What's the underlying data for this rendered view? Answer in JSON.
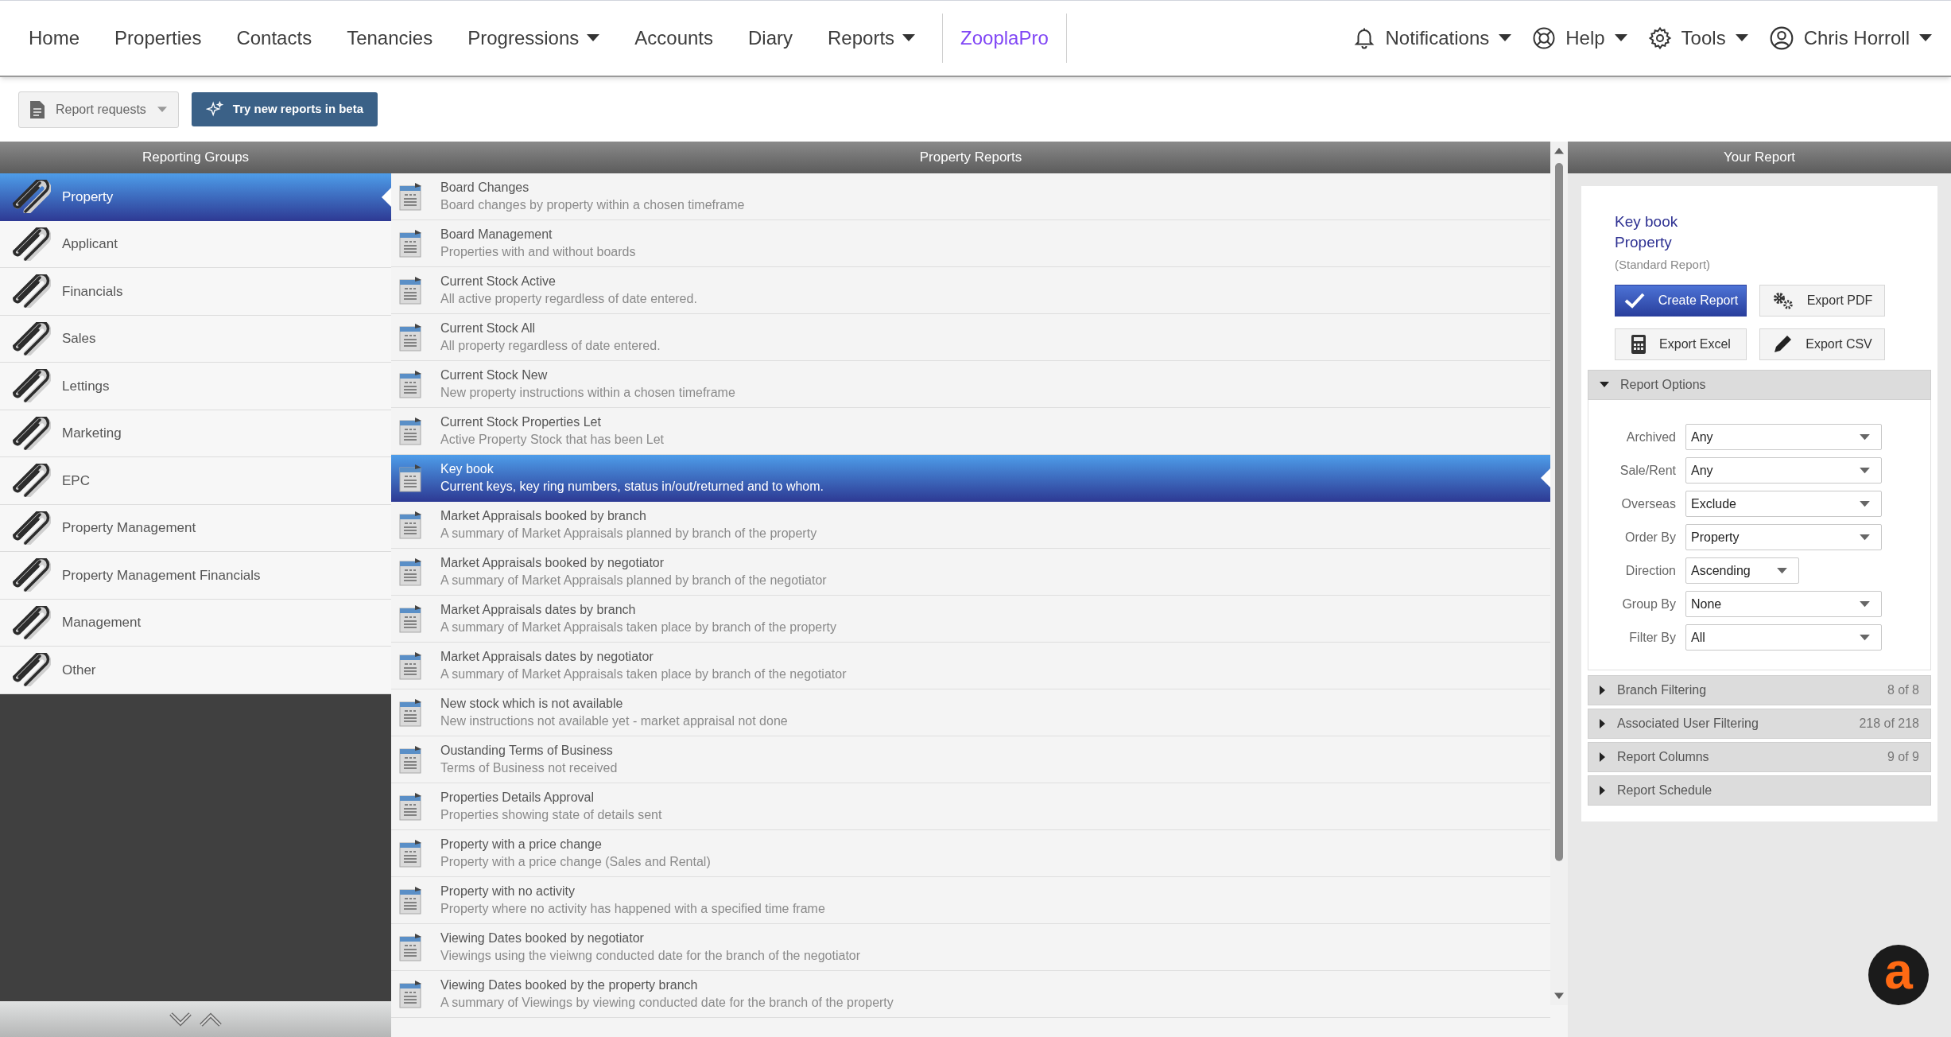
{
  "nav": {
    "items": [
      {
        "label": "Home",
        "dropdown": false
      },
      {
        "label": "Properties",
        "dropdown": false
      },
      {
        "label": "Contacts",
        "dropdown": false
      },
      {
        "label": "Tenancies",
        "dropdown": false
      },
      {
        "label": "Progressions",
        "dropdown": true
      },
      {
        "label": "Accounts",
        "dropdown": false
      },
      {
        "label": "Diary",
        "dropdown": false
      },
      {
        "label": "Reports",
        "dropdown": true
      }
    ],
    "brand_link": "ZooplaPro",
    "right": [
      {
        "label": "Notifications",
        "dropdown": true
      },
      {
        "label": "Help",
        "dropdown": true
      },
      {
        "label": "Tools",
        "dropdown": true
      },
      {
        "label": "Chris Horroll",
        "dropdown": true
      }
    ]
  },
  "toolbar": {
    "report_requests": "Report requests",
    "beta_button": "Try new reports in beta"
  },
  "groups": {
    "title": "Reporting Groups",
    "items": [
      {
        "label": "Property",
        "selected": true
      },
      {
        "label": "Applicant",
        "selected": false
      },
      {
        "label": "Financials",
        "selected": false
      },
      {
        "label": "Sales",
        "selected": false
      },
      {
        "label": "Lettings",
        "selected": false
      },
      {
        "label": "Marketing",
        "selected": false
      },
      {
        "label": "EPC",
        "selected": false
      },
      {
        "label": "Property Management",
        "selected": false
      },
      {
        "label": "Property Management Financials",
        "selected": false
      },
      {
        "label": "Management",
        "selected": false
      },
      {
        "label": "Other",
        "selected": false
      }
    ]
  },
  "reports": {
    "title": "Property Reports",
    "items": [
      {
        "title": "Board Changes",
        "description": "Board changes by property within a chosen timeframe",
        "selected": false
      },
      {
        "title": "Board Management",
        "description": "Properties with and without boards",
        "selected": false
      },
      {
        "title": "Current Stock Active",
        "description": "All active property regardless of date entered.",
        "selected": false
      },
      {
        "title": "Current Stock All",
        "description": "All property regardless of date entered.",
        "selected": false
      },
      {
        "title": "Current Stock New",
        "description": "New property instructions within a chosen timeframe",
        "selected": false
      },
      {
        "title": "Current Stock Properties Let",
        "description": "Active Property Stock that has been Let",
        "selected": false
      },
      {
        "title": "Key book",
        "description": "Current keys, key ring numbers, status in/out/returned and to whom.",
        "selected": true
      },
      {
        "title": "Market Appraisals booked by branch",
        "description": "A summary of Market Appraisals planned by branch of the property",
        "selected": false
      },
      {
        "title": "Market Appraisals booked by negotiator",
        "description": "A summary of Market Appraisals planned by branch of the negotiator",
        "selected": false
      },
      {
        "title": "Market Appraisals dates by branch",
        "description": "A summary of Market Appraisals taken place by branch of the property",
        "selected": false
      },
      {
        "title": "Market Appraisals dates by negotiator",
        "description": "A summary of Market Appraisals taken place by branch of the negotiator",
        "selected": false
      },
      {
        "title": "New stock which is not available",
        "description": "New instructions not available yet - market appraisal not done",
        "selected": false
      },
      {
        "title": "Oustanding Terms of Business",
        "description": "Terms of Business not received",
        "selected": false
      },
      {
        "title": "Properties Details Approval",
        "description": "Properties showing state of details sent",
        "selected": false
      },
      {
        "title": "Property with a price change",
        "description": "Property with a price change (Sales and Rental)",
        "selected": false
      },
      {
        "title": "Property with no activity",
        "description": "Property where no activity has happened with a specified time frame",
        "selected": false
      },
      {
        "title": "Viewing Dates booked by negotiator",
        "description": "Viewings using the vieiwng conducted date for the branch of the negotiator",
        "selected": false
      },
      {
        "title": "Viewing Dates booked by the property branch",
        "description": "A summary of Viewings by viewing conducted date for the branch of the property",
        "selected": false
      }
    ]
  },
  "your_report": {
    "title": "Your Report",
    "report_name": "Key book",
    "group": "Property",
    "type": "(Standard Report)",
    "buttons": [
      {
        "label": "Create Report",
        "kind": "create"
      },
      {
        "label": "Export PDF",
        "kind": "pdf"
      },
      {
        "label": "Export Excel",
        "kind": "excel"
      },
      {
        "label": "Export CSV",
        "kind": "csv"
      }
    ],
    "sections": [
      {
        "label": "Report Options",
        "expanded": true,
        "options": [
          {
            "label": "Archived",
            "value": "Any",
            "kind": "wide"
          },
          {
            "label": "Sale/Rent",
            "value": "Any",
            "kind": "wide"
          },
          {
            "label": "Overseas",
            "value": "Exclude",
            "kind": "wide"
          },
          {
            "label": "Order By",
            "value": "Property",
            "kind": "wide"
          },
          {
            "label": "Direction",
            "value": "Ascending",
            "kind": "narrow"
          },
          {
            "label": "Group By",
            "value": "None",
            "kind": "wide"
          },
          {
            "label": "Filter By",
            "value": "All",
            "kind": "wide"
          }
        ]
      },
      {
        "label": "Branch Filtering",
        "expanded": false,
        "count": "8 of 8"
      },
      {
        "label": "Associated User Filtering",
        "expanded": false,
        "count": "218 of 218"
      },
      {
        "label": "Report Columns",
        "expanded": false,
        "count": "9 of 9"
      },
      {
        "label": "Report Schedule",
        "expanded": false
      }
    ]
  },
  "chat_widget": {
    "label": "a"
  }
}
